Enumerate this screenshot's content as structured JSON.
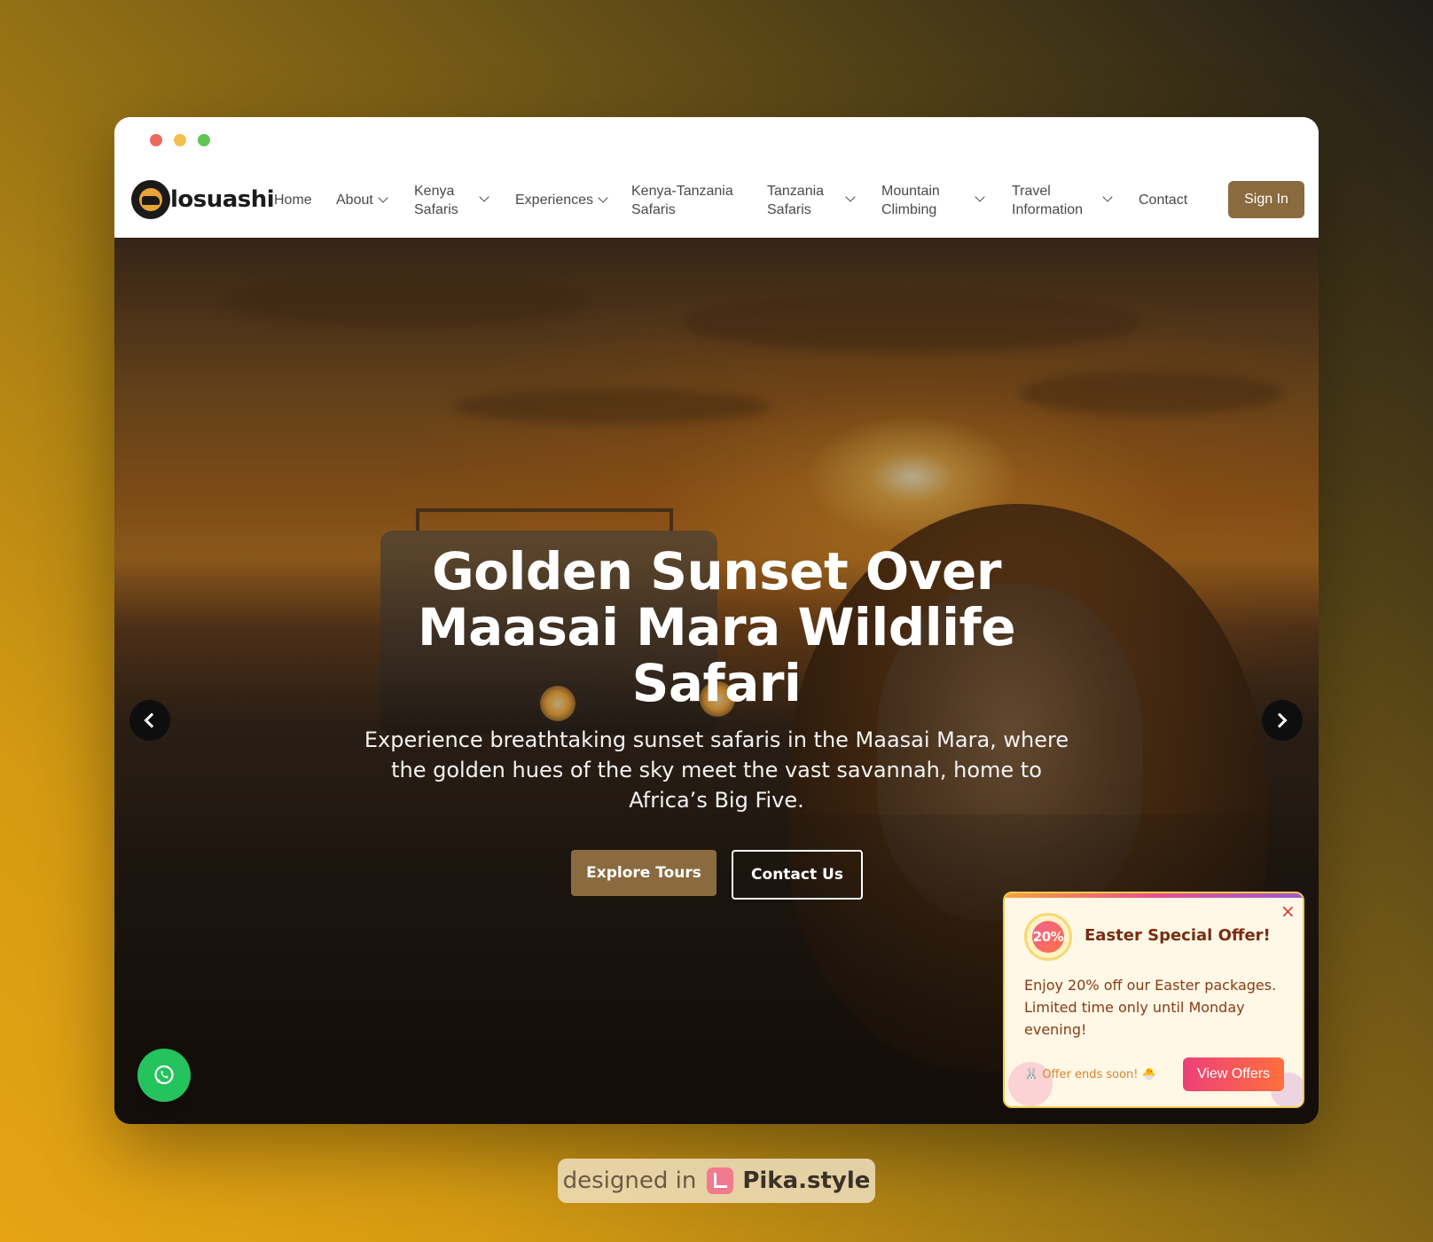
{
  "window": {
    "controls": [
      "close",
      "minimize",
      "maximize"
    ]
  },
  "nav": {
    "logo_text": "losuashi",
    "logo_icon": "lion-sunset-logo-icon",
    "items": [
      {
        "label": "Home",
        "dropdown": false
      },
      {
        "label": "About",
        "dropdown": true
      },
      {
        "label": "Kenya Safaris",
        "dropdown": true
      },
      {
        "label": "Experiences",
        "dropdown": true
      },
      {
        "label": "Kenya-Tanzania Safaris",
        "dropdown": false
      },
      {
        "label": "Tanzania Safaris",
        "dropdown": true
      },
      {
        "label": "Mountain Climbing",
        "dropdown": true
      },
      {
        "label": "Travel Information",
        "dropdown": true
      },
      {
        "label": "Contact",
        "dropdown": false
      }
    ],
    "signin_label": "Sign In"
  },
  "hero": {
    "title": "Golden Sunset Over Maasai Mara Wildlife Safari",
    "subtitle": "Experience breathtaking sunset safaris in the Maasai Mara, where the golden hues of the sky meet the vast savannah, home to Africa’s Big Five.",
    "primary_button": "Explore Tours",
    "secondary_button": "Contact Us",
    "prev_icon": "chevron-left-icon",
    "next_icon": "chevron-right-icon"
  },
  "whatsapp": {
    "icon": "whatsapp-icon"
  },
  "promo": {
    "badge": "20%",
    "title": "Easter Special Offer!",
    "body": "Enjoy 20% off our Easter packages. Limited time only until Monday evening!",
    "footnote": "🐰 Offer ends soon! 🐣",
    "button": "View Offers",
    "close_icon": "close-icon"
  },
  "credit": {
    "prefix": "designed in",
    "name": "Pika.style"
  },
  "colors": {
    "brand": "#8a6a3f",
    "promo_border": "#f2c94c",
    "promo_button_start": "#ec407a",
    "promo_button_end": "#ff6f3c",
    "whatsapp": "#25c35d"
  }
}
